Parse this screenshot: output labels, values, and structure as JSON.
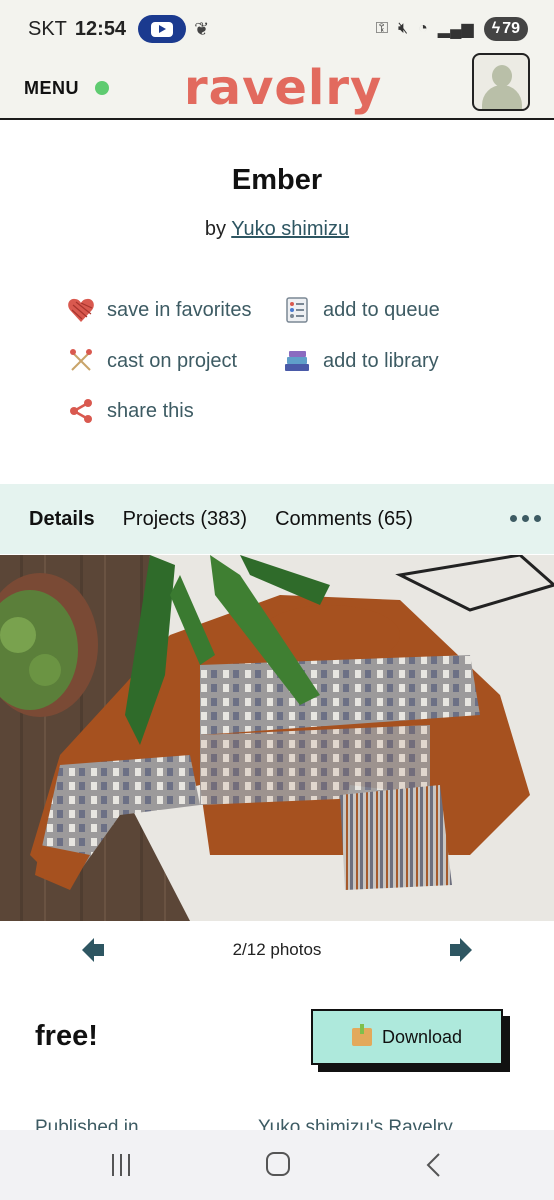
{
  "status_bar": {
    "carrier": "SKT",
    "time": "12:54",
    "battery": "79"
  },
  "header": {
    "menu_label": "MENU",
    "logo": "ravelry"
  },
  "pattern": {
    "title": "Ember",
    "by_prefix": "by",
    "designer": "Yuko shimizu"
  },
  "actions": [
    {
      "label": "save in favorites",
      "icon": "yarn-heart-icon"
    },
    {
      "label": "add to queue",
      "icon": "queue-list-icon"
    },
    {
      "label": "cast on project",
      "icon": "knitting-needles-icon"
    },
    {
      "label": "add to library",
      "icon": "books-icon"
    },
    {
      "label": "share this",
      "icon": "share-icon"
    }
  ],
  "tabs": [
    {
      "label": "Details",
      "active": true
    },
    {
      "label": "Projects (383)",
      "active": false
    },
    {
      "label": "Comments (65)",
      "active": false
    }
  ],
  "photos": {
    "counter": "2/12 photos"
  },
  "price": {
    "label": "free!",
    "download_label": "Download"
  },
  "info_rows": {
    "published_in_label": "Published in",
    "published_in_value": "Yuko shimizu's Ravelry"
  },
  "colors": {
    "brand": "#e26a5e",
    "accent": "#3d5b63",
    "tab_bg": "#e5f3ef",
    "download_bg": "#aee9dc",
    "header_bg": "#f3f3ee"
  }
}
